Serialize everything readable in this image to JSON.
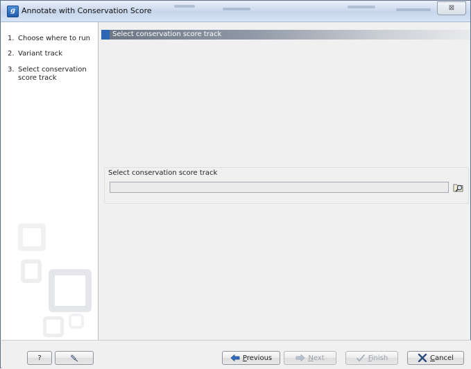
{
  "window": {
    "title": "Annotate with Conservation Score",
    "app_icon_letter": "g",
    "close_symbol": "⊠"
  },
  "sidebar": {
    "steps": [
      {
        "num": "1.",
        "label": "Choose where to run"
      },
      {
        "num": "2.",
        "label": "Variant track"
      },
      {
        "num": "3.",
        "label": "Select conservation score track"
      }
    ]
  },
  "main": {
    "header": "Select conservation score track",
    "group_label": "Select conservation score track",
    "track_input_value": "",
    "browse_icon": "folder-search-icon"
  },
  "footer": {
    "help_label": "?",
    "reset_icon": "pin-icon",
    "previous_label": "Previous",
    "next_label": "Next",
    "finish_label": "Finish",
    "cancel_label": "Cancel"
  },
  "colors": {
    "accent": "#2d66b5",
    "title_bar": "#d3def0",
    "header_gradient_start": "#6a7482",
    "sidebar_bg": "#ffffff"
  }
}
